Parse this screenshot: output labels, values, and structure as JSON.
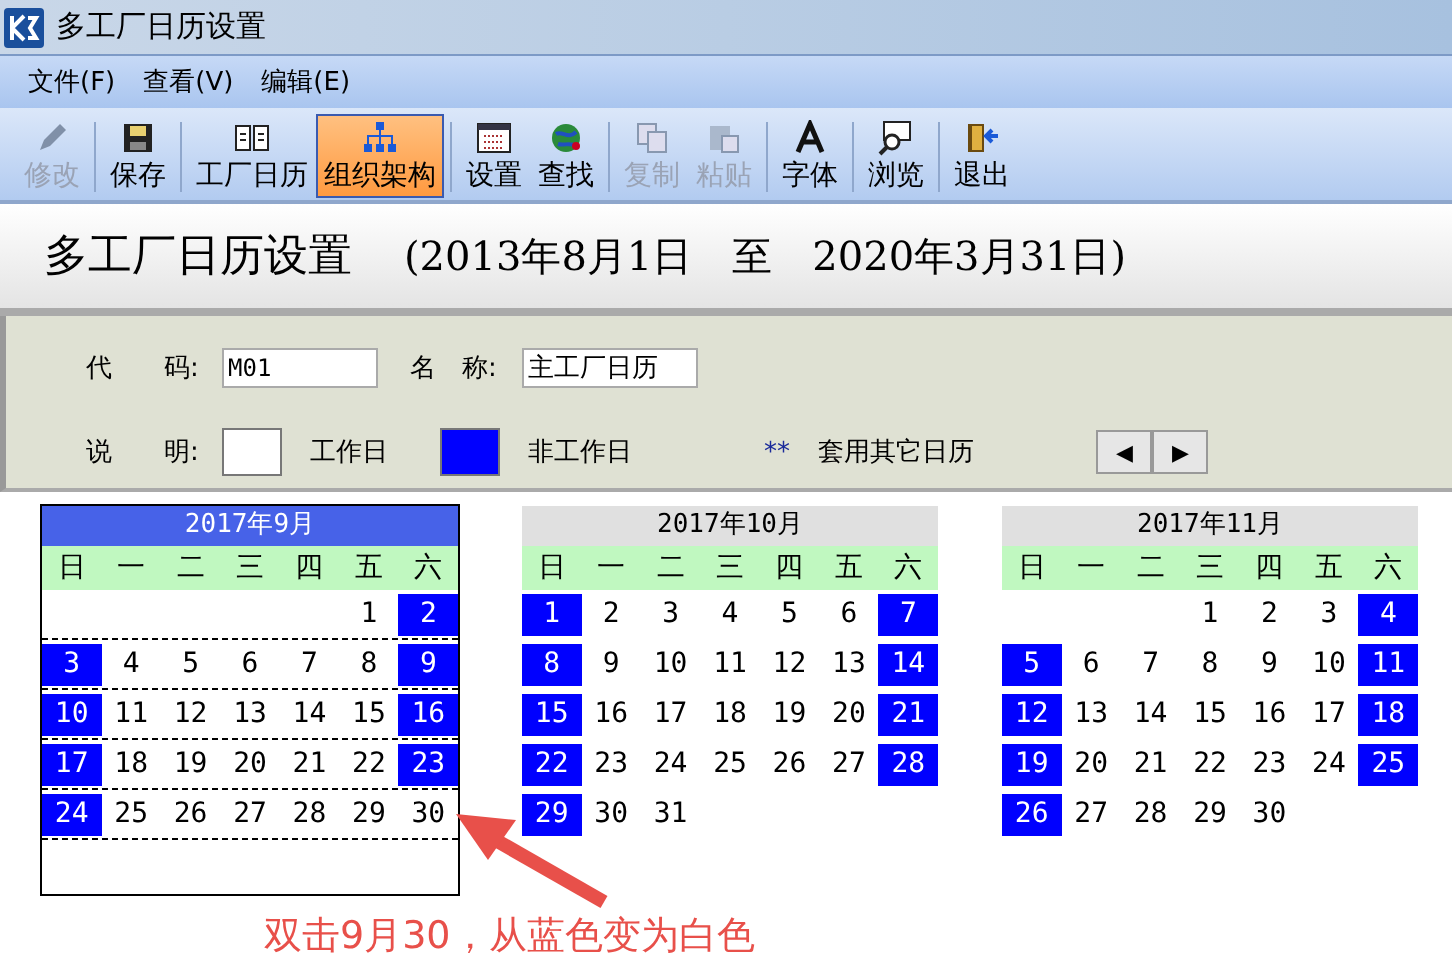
{
  "window": {
    "title": "多工厂日历设置"
  },
  "menu": [
    {
      "label": "文件(F)"
    },
    {
      "label": "查看(V)"
    },
    {
      "label": "编辑(E)"
    }
  ],
  "toolbar": [
    {
      "label": "修改",
      "kind": "pencil",
      "disabled": true,
      "selected": false
    },
    {
      "label": "保存",
      "kind": "save",
      "disabled": false,
      "selected": false
    },
    {
      "label": "工厂日历",
      "kind": "book",
      "disabled": false,
      "selected": false
    },
    {
      "label": "组织架构",
      "kind": "org",
      "disabled": false,
      "selected": true
    },
    {
      "label": "设置",
      "kind": "grid",
      "disabled": false,
      "selected": false
    },
    {
      "label": "查找",
      "kind": "globe",
      "disabled": false,
      "selected": false
    },
    {
      "label": "复制",
      "kind": "copy",
      "disabled": true,
      "selected": false
    },
    {
      "label": "粘贴",
      "kind": "paste",
      "disabled": true,
      "selected": false
    },
    {
      "label": "字体",
      "kind": "font",
      "disabled": false,
      "selected": false
    },
    {
      "label": "浏览",
      "kind": "browse",
      "disabled": false,
      "selected": false
    },
    {
      "label": "退出",
      "kind": "exit",
      "disabled": false,
      "selected": false
    }
  ],
  "heading": {
    "title": "多工厂日历设置",
    "range": "(2013年8月1日　至　2020年3月31日)"
  },
  "form": {
    "code_label": "代　　码:",
    "code_value": "M01",
    "name_label": "名　称:",
    "name_value": "主工厂日历",
    "desc_label": "说　　明:",
    "workday_label": "工作日",
    "offday_label": "非工作日",
    "stars": "**",
    "other_label": "套用其它日历",
    "prev": "◀",
    "next": "▶"
  },
  "months": [
    {
      "title": "2017年9月",
      "selected": true,
      "weekdays": [
        "日",
        "一",
        "二",
        "三",
        "四",
        "五",
        "六"
      ],
      "weeks": [
        [
          {
            "kind": "blank"
          },
          {
            "kind": "blank"
          },
          {
            "kind": "blank"
          },
          {
            "kind": "blank"
          },
          {
            "kind": "blank"
          },
          {
            "kind": "day",
            "day": "1",
            "off": false
          },
          {
            "kind": "day",
            "day": "2",
            "off": true
          }
        ],
        [
          {
            "kind": "day",
            "day": "3",
            "off": true
          },
          {
            "kind": "day",
            "day": "4",
            "off": false
          },
          {
            "kind": "day",
            "day": "5",
            "off": false
          },
          {
            "kind": "day",
            "day": "6",
            "off": false
          },
          {
            "kind": "day",
            "day": "7",
            "off": false
          },
          {
            "kind": "day",
            "day": "8",
            "off": false
          },
          {
            "kind": "day",
            "day": "9",
            "off": true
          }
        ],
        [
          {
            "kind": "day",
            "day": "10",
            "off": true
          },
          {
            "kind": "day",
            "day": "11",
            "off": false
          },
          {
            "kind": "day",
            "day": "12",
            "off": false
          },
          {
            "kind": "day",
            "day": "13",
            "off": false
          },
          {
            "kind": "day",
            "day": "14",
            "off": false
          },
          {
            "kind": "day",
            "day": "15",
            "off": false
          },
          {
            "kind": "day",
            "day": "16",
            "off": true
          }
        ],
        [
          {
            "kind": "day",
            "day": "17",
            "off": true
          },
          {
            "kind": "day",
            "day": "18",
            "off": false
          },
          {
            "kind": "day",
            "day": "19",
            "off": false
          },
          {
            "kind": "day",
            "day": "20",
            "off": false
          },
          {
            "kind": "day",
            "day": "21",
            "off": false
          },
          {
            "kind": "day",
            "day": "22",
            "off": false
          },
          {
            "kind": "day",
            "day": "23",
            "off": true
          }
        ],
        [
          {
            "kind": "day",
            "day": "24",
            "off": true
          },
          {
            "kind": "day",
            "day": "25",
            "off": false
          },
          {
            "kind": "day",
            "day": "26",
            "off": false
          },
          {
            "kind": "day",
            "day": "27",
            "off": false
          },
          {
            "kind": "day",
            "day": "28",
            "off": false
          },
          {
            "kind": "day",
            "day": "29",
            "off": false
          },
          {
            "kind": "day",
            "day": "30",
            "off": false
          }
        ]
      ]
    },
    {
      "title": "2017年10月",
      "selected": false,
      "weekdays": [
        "日",
        "一",
        "二",
        "三",
        "四",
        "五",
        "六"
      ],
      "weeks": [
        [
          {
            "kind": "day",
            "day": "1",
            "off": true
          },
          {
            "kind": "day",
            "day": "2",
            "off": false
          },
          {
            "kind": "day",
            "day": "3",
            "off": false
          },
          {
            "kind": "day",
            "day": "4",
            "off": false
          },
          {
            "kind": "day",
            "day": "5",
            "off": false
          },
          {
            "kind": "day",
            "day": "6",
            "off": false
          },
          {
            "kind": "day",
            "day": "7",
            "off": true
          }
        ],
        [
          {
            "kind": "day",
            "day": "8",
            "off": true
          },
          {
            "kind": "day",
            "day": "9",
            "off": false
          },
          {
            "kind": "day",
            "day": "10",
            "off": false
          },
          {
            "kind": "day",
            "day": "11",
            "off": false
          },
          {
            "kind": "day",
            "day": "12",
            "off": false
          },
          {
            "kind": "day",
            "day": "13",
            "off": false
          },
          {
            "kind": "day",
            "day": "14",
            "off": true
          }
        ],
        [
          {
            "kind": "day",
            "day": "15",
            "off": true
          },
          {
            "kind": "day",
            "day": "16",
            "off": false
          },
          {
            "kind": "day",
            "day": "17",
            "off": false
          },
          {
            "kind": "day",
            "day": "18",
            "off": false
          },
          {
            "kind": "day",
            "day": "19",
            "off": false
          },
          {
            "kind": "day",
            "day": "20",
            "off": false
          },
          {
            "kind": "day",
            "day": "21",
            "off": true
          }
        ],
        [
          {
            "kind": "day",
            "day": "22",
            "off": true
          },
          {
            "kind": "day",
            "day": "23",
            "off": false
          },
          {
            "kind": "day",
            "day": "24",
            "off": false
          },
          {
            "kind": "day",
            "day": "25",
            "off": false
          },
          {
            "kind": "day",
            "day": "26",
            "off": false
          },
          {
            "kind": "day",
            "day": "27",
            "off": false
          },
          {
            "kind": "day",
            "day": "28",
            "off": true
          }
        ],
        [
          {
            "kind": "day",
            "day": "29",
            "off": true
          },
          {
            "kind": "day",
            "day": "30",
            "off": false
          },
          {
            "kind": "day",
            "day": "31",
            "off": false
          },
          {
            "kind": "blank"
          },
          {
            "kind": "blank"
          },
          {
            "kind": "blank"
          },
          {
            "kind": "blank"
          }
        ]
      ]
    },
    {
      "title": "2017年11月",
      "selected": false,
      "weekdays": [
        "日",
        "一",
        "二",
        "三",
        "四",
        "五",
        "六"
      ],
      "weeks": [
        [
          {
            "kind": "blank"
          },
          {
            "kind": "blank"
          },
          {
            "kind": "blank"
          },
          {
            "kind": "day",
            "day": "1",
            "off": false
          },
          {
            "kind": "day",
            "day": "2",
            "off": false
          },
          {
            "kind": "day",
            "day": "3",
            "off": false
          },
          {
            "kind": "day",
            "day": "4",
            "off": true
          }
        ],
        [
          {
            "kind": "day",
            "day": "5",
            "off": true
          },
          {
            "kind": "day",
            "day": "6",
            "off": false
          },
          {
            "kind": "day",
            "day": "7",
            "off": false
          },
          {
            "kind": "day",
            "day": "8",
            "off": false
          },
          {
            "kind": "day",
            "day": "9",
            "off": false
          },
          {
            "kind": "day",
            "day": "10",
            "off": false
          },
          {
            "kind": "day",
            "day": "11",
            "off": true
          }
        ],
        [
          {
            "kind": "day",
            "day": "12",
            "off": true
          },
          {
            "kind": "day",
            "day": "13",
            "off": false
          },
          {
            "kind": "day",
            "day": "14",
            "off": false
          },
          {
            "kind": "day",
            "day": "15",
            "off": false
          },
          {
            "kind": "day",
            "day": "16",
            "off": false
          },
          {
            "kind": "day",
            "day": "17",
            "off": false
          },
          {
            "kind": "day",
            "day": "18",
            "off": true
          }
        ],
        [
          {
            "kind": "day",
            "day": "19",
            "off": true
          },
          {
            "kind": "day",
            "day": "20",
            "off": false
          },
          {
            "kind": "day",
            "day": "21",
            "off": false
          },
          {
            "kind": "day",
            "day": "22",
            "off": false
          },
          {
            "kind": "day",
            "day": "23",
            "off": false
          },
          {
            "kind": "day",
            "day": "24",
            "off": false
          },
          {
            "kind": "day",
            "day": "25",
            "off": true
          }
        ],
        [
          {
            "kind": "day",
            "day": "26",
            "off": true
          },
          {
            "kind": "day",
            "day": "27",
            "off": false
          },
          {
            "kind": "day",
            "day": "28",
            "off": false
          },
          {
            "kind": "day",
            "day": "29",
            "off": false
          },
          {
            "kind": "day",
            "day": "30",
            "off": false
          },
          {
            "kind": "blank"
          },
          {
            "kind": "blank"
          }
        ]
      ]
    }
  ],
  "annotation": {
    "text": "双击9月30，从蓝色变为白色"
  }
}
